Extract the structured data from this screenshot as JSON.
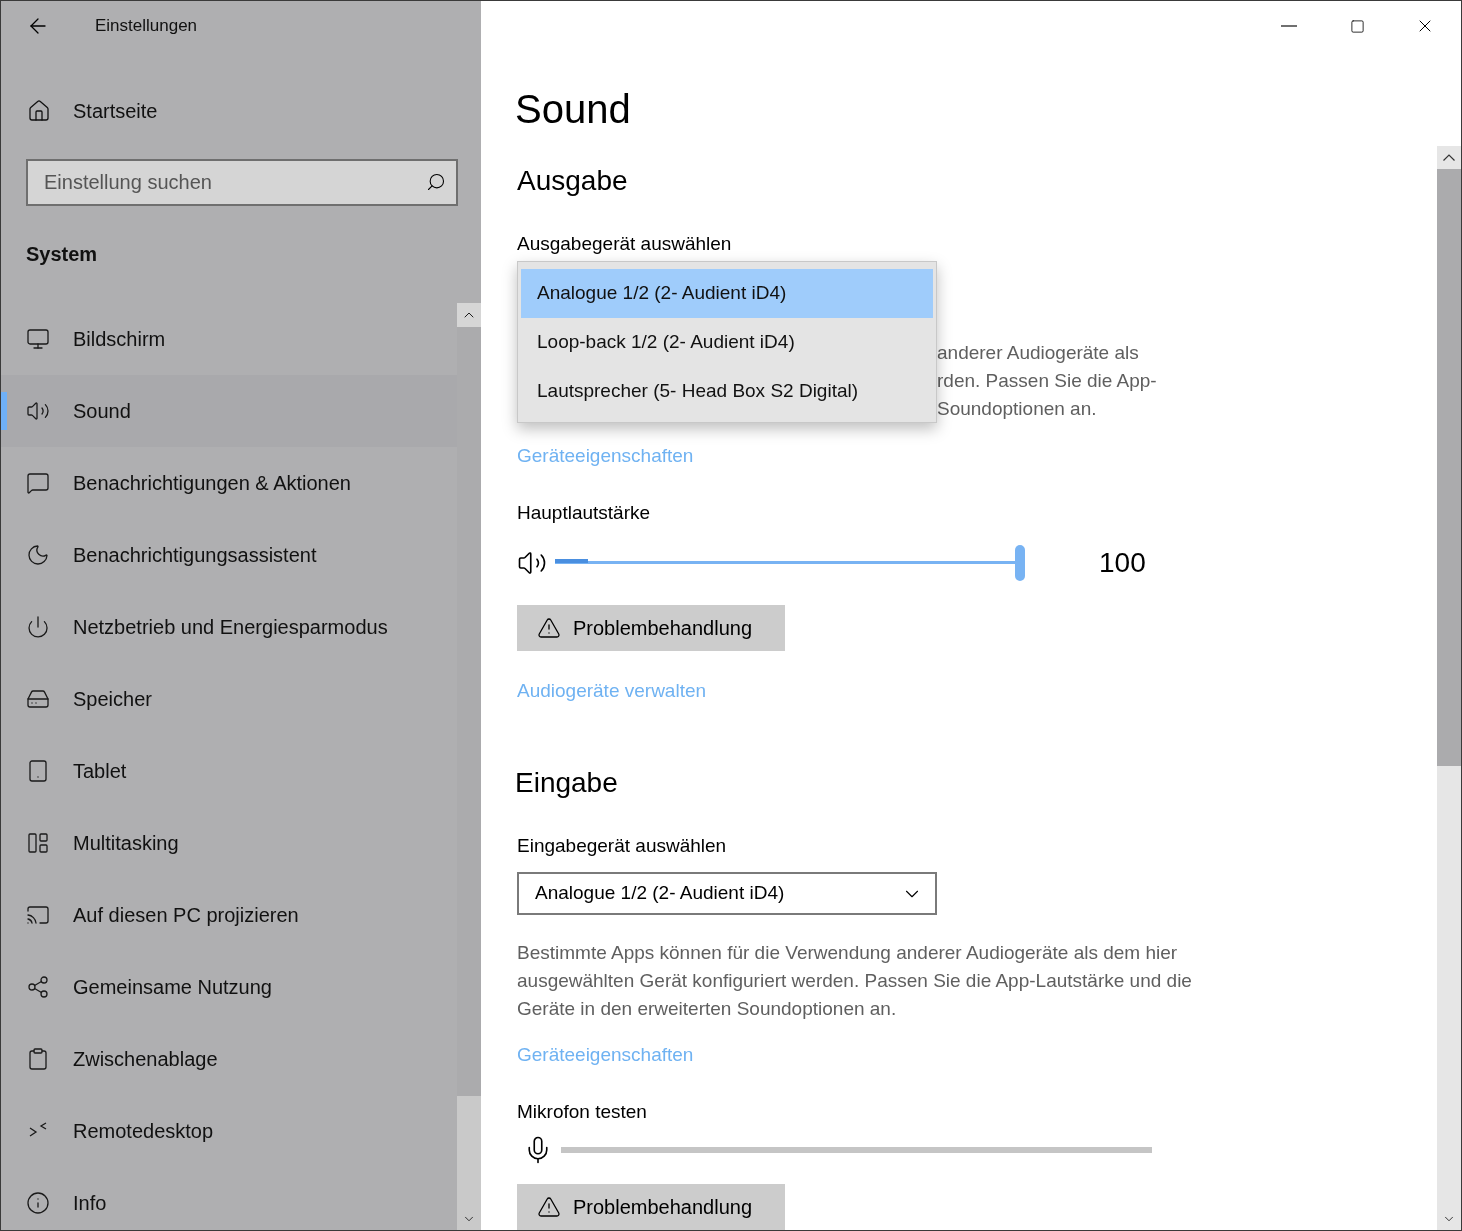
{
  "window": {
    "title": "Einstellungen"
  },
  "sidebar": {
    "home": "Startseite",
    "search": {
      "placeholder": "Einstellung suchen"
    },
    "section": "System",
    "items": [
      {
        "label": "Bildschirm",
        "selected": false
      },
      {
        "label": "Sound",
        "selected": true
      },
      {
        "label": "Benachrichtigungen & Aktionen",
        "selected": false
      },
      {
        "label": "Benachrichtigungsassistent",
        "selected": false
      },
      {
        "label": "Netzbetrieb und Energiesparmodus",
        "selected": false
      },
      {
        "label": "Speicher",
        "selected": false
      },
      {
        "label": "Tablet",
        "selected": false
      },
      {
        "label": "Multitasking",
        "selected": false
      },
      {
        "label": "Auf diesen PC projizieren",
        "selected": false
      },
      {
        "label": "Gemeinsame Nutzung",
        "selected": false
      },
      {
        "label": "Zwischenablage",
        "selected": false
      },
      {
        "label": "Remotedesktop",
        "selected": false
      },
      {
        "label": "Info",
        "selected": false
      }
    ]
  },
  "main": {
    "title": "Sound",
    "output": {
      "heading": "Ausgabe",
      "device_label": "Ausgabegerät auswählen",
      "dropdown_options": [
        {
          "label": "Analogue 1/2 (2- Audient iD4)",
          "selected": true
        },
        {
          "label": "Loop-back 1/2 (2- Audient iD4)",
          "selected": false
        },
        {
          "label": "Lautsprecher (5- Head Box S2 Digital)",
          "selected": false
        }
      ],
      "description_visible_parts": [
        "anderer Audiogeräte als",
        "rden. Passen Sie die App-",
        "Soundoptionen an."
      ],
      "properties_link": "Geräteeigenschaften",
      "volume_label": "Hauptlautstärke",
      "volume": {
        "level": 1,
        "reading": "100"
      },
      "troubleshoot_button": "Problembehandlung",
      "manage_link": "Audiogeräte verwalten"
    },
    "input": {
      "heading": "Eingabe",
      "device_label": "Eingabegerät auswählen",
      "device": "Analogue 1/2 (2- Audient iD4)",
      "description": "Bestimmte Apps können für die Verwendung anderer Audiogeräte als dem hier ausgewählten Gerät konfiguriert werden. Passen Sie die App-Lautstärke und die Geräte in den erweiterten Soundoptionen an.",
      "properties_link": "Geräteeigenschaften",
      "mic_label": "Mikrofon testen",
      "mic": {
        "level": 0
      },
      "troubleshoot_button": "Problembehandlung"
    }
  }
}
